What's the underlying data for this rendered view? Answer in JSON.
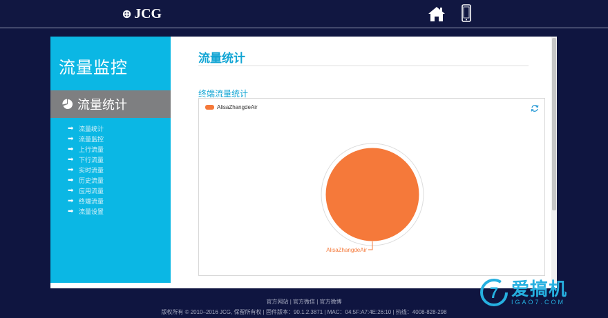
{
  "header": {
    "brand": "JCG",
    "home_icon": "home-icon",
    "mobile_icon": "mobile-phone-icon"
  },
  "sidebar": {
    "title": "流量监控",
    "active_label": "流量统计",
    "active_icon": "pie-chart-icon",
    "items": [
      {
        "label": "流量统计"
      },
      {
        "label": "流量监控"
      },
      {
        "label": "上行流量"
      },
      {
        "label": "下行流量"
      },
      {
        "label": "实时流量"
      },
      {
        "label": "历史流量"
      },
      {
        "label": "应用流量"
      },
      {
        "label": "终端流量"
      },
      {
        "label": "流量设置"
      }
    ]
  },
  "main": {
    "page_title": "流量统计",
    "section_label": "终端流量统计",
    "legend_label": "AlisaZhangdeAir",
    "refresh_icon": "refresh-icon"
  },
  "chart_data": {
    "type": "pie",
    "slices": [
      {
        "label": "AlisaZhangdeAir",
        "value": 100,
        "color": "#f5793a"
      }
    ]
  },
  "footer": {
    "links": "官方网站 | 官方微信 | 官方微博",
    "info": "版权所有 © 2010–2016 JCG, 保留所有权 | 固件版本：90.1.2.3871 | MAC：04:5F:A7:4E:26:10 | 热线：4008-828-298"
  },
  "watermark": {
    "cn": "爱搞机",
    "en": "IGAO7.COM",
    "mark": "7"
  },
  "colors": {
    "accent": "#0bb7e4",
    "pie": "#f5793a",
    "background": "#0f1540"
  }
}
